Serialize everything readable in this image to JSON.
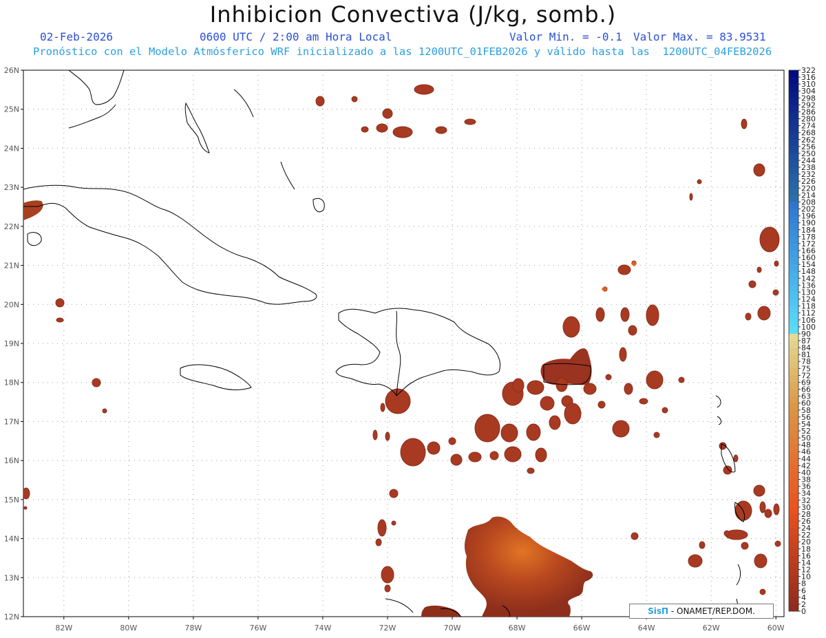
{
  "header": {
    "title": "Inhibicion Convectiva (J/kg, somb.)",
    "date": "02-Feb-2026",
    "time": "0600 UTC / 2:00 am Hora Local",
    "min_label": "Valor Min. = -0.1",
    "max_label": "Valor Max. = 83.9531",
    "subtitle": "Pronóstico con el Modelo Atmósferico WRF inicializado a las 1200UTC_01FEB2026 y válido hasta las  1200UTC_04FEB2026"
  },
  "axes": {
    "lat_labels": [
      "26N",
      "25N",
      "24N",
      "23N",
      "22N",
      "21N",
      "20N",
      "19N",
      "18N",
      "17N",
      "16N",
      "15N",
      "14N",
      "13N",
      "12N"
    ],
    "lon_labels": [
      "82W",
      "80W",
      "78W",
      "76W",
      "74W",
      "72W",
      "70W",
      "68W",
      "66W",
      "64W",
      "62W",
      "60W"
    ]
  },
  "colorbar": {
    "labels": [
      "322",
      "316",
      "310",
      "304",
      "298",
      "292",
      "286",
      "280",
      "274",
      "268",
      "262",
      "256",
      "250",
      "244",
      "238",
      "232",
      "226",
      "220",
      "214",
      "208",
      "202",
      "196",
      "190",
      "184",
      "178",
      "172",
      "166",
      "160",
      "154",
      "148",
      "142",
      "136",
      "130",
      "124",
      "118",
      "112",
      "106",
      "100",
      "90",
      "87",
      "84",
      "81",
      "78",
      "75",
      "72",
      "69",
      "66",
      "63",
      "60",
      "58",
      "56",
      "54",
      "52",
      "50",
      "48",
      "46",
      "44",
      "42",
      "40",
      "38",
      "36",
      "34",
      "32",
      "30",
      "28",
      "26",
      "24",
      "22",
      "20",
      "18",
      "16",
      "14",
      "12",
      "10",
      "8",
      "6",
      "4",
      "2",
      "0"
    ]
  },
  "credit": {
    "logo": "SisΠ",
    "text": " - ONAMET/REP.DOM."
  },
  "colors": {
    "field_dark": "#8a2d1c",
    "field_mid": "#a83a22",
    "field_hot": "#d9651e",
    "coast": "#000000",
    "grid": "#999999"
  }
}
